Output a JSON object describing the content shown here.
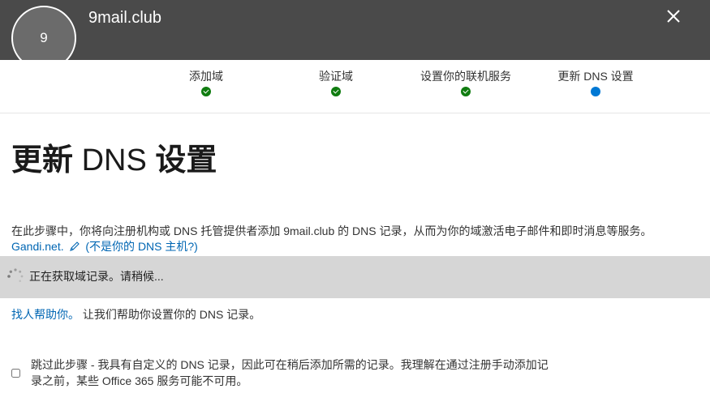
{
  "header": {
    "avatar_text": "9",
    "domain": "9mail.club",
    "close_icon": "close-icon",
    "bg_color": "#4a4a4a"
  },
  "steps": [
    {
      "label": "添加域",
      "status": "complete"
    },
    {
      "label": "验证域",
      "status": "complete"
    },
    {
      "label": "设置你的联机服务",
      "status": "complete"
    },
    {
      "label": "更新 DNS 设置",
      "status": "current"
    }
  ],
  "page": {
    "title_bold_1": "更新",
    "title_regular": " DNS ",
    "title_bold_2": "设置",
    "description": "在此步骤中，你将向注册机构或 DNS 托管提供者添加 9mail.club 的 DNS 记录，从而为你的域激活电子邮件和即时消息等服务。",
    "provider": "Gandi.net.",
    "not_your_host": "(不是你的 DNS 主机?)",
    "loading_text": "正在获取域记录。请稍候...",
    "help_link": "找人帮助你。",
    "help_text": " 让我们帮助你设置你的 DNS 记录。",
    "skip_line1": "跳过此步骤 - 我具有自定义的 DNS 记录，因此可在稍后添加所需的记录。我理解在通过注册手动添加记",
    "skip_line2": "录之前，某些 Office 365 服务可能不可用。",
    "skip_checked": false
  },
  "colors": {
    "step_done": "#107c10",
    "step_current": "#0078d4",
    "link": "#0066b3",
    "loading_bar": "#d6d6d6"
  }
}
